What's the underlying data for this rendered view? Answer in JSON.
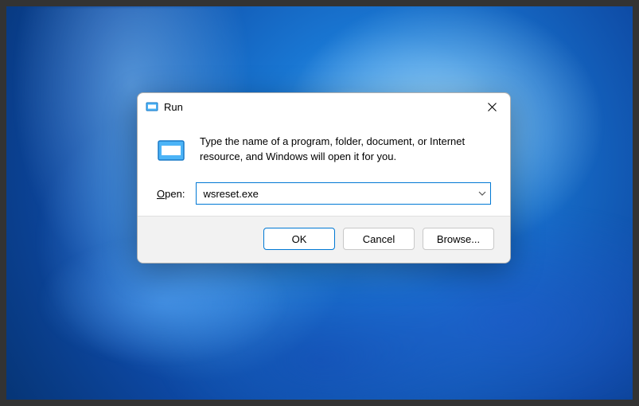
{
  "dialog": {
    "title": "Run",
    "description": "Type the name of a program, folder, document, or Internet resource, and Windows will open it for you.",
    "open_label": "Open:",
    "input_value": "wsreset.exe",
    "buttons": {
      "ok": "OK",
      "cancel": "Cancel",
      "browse": "Browse..."
    }
  }
}
